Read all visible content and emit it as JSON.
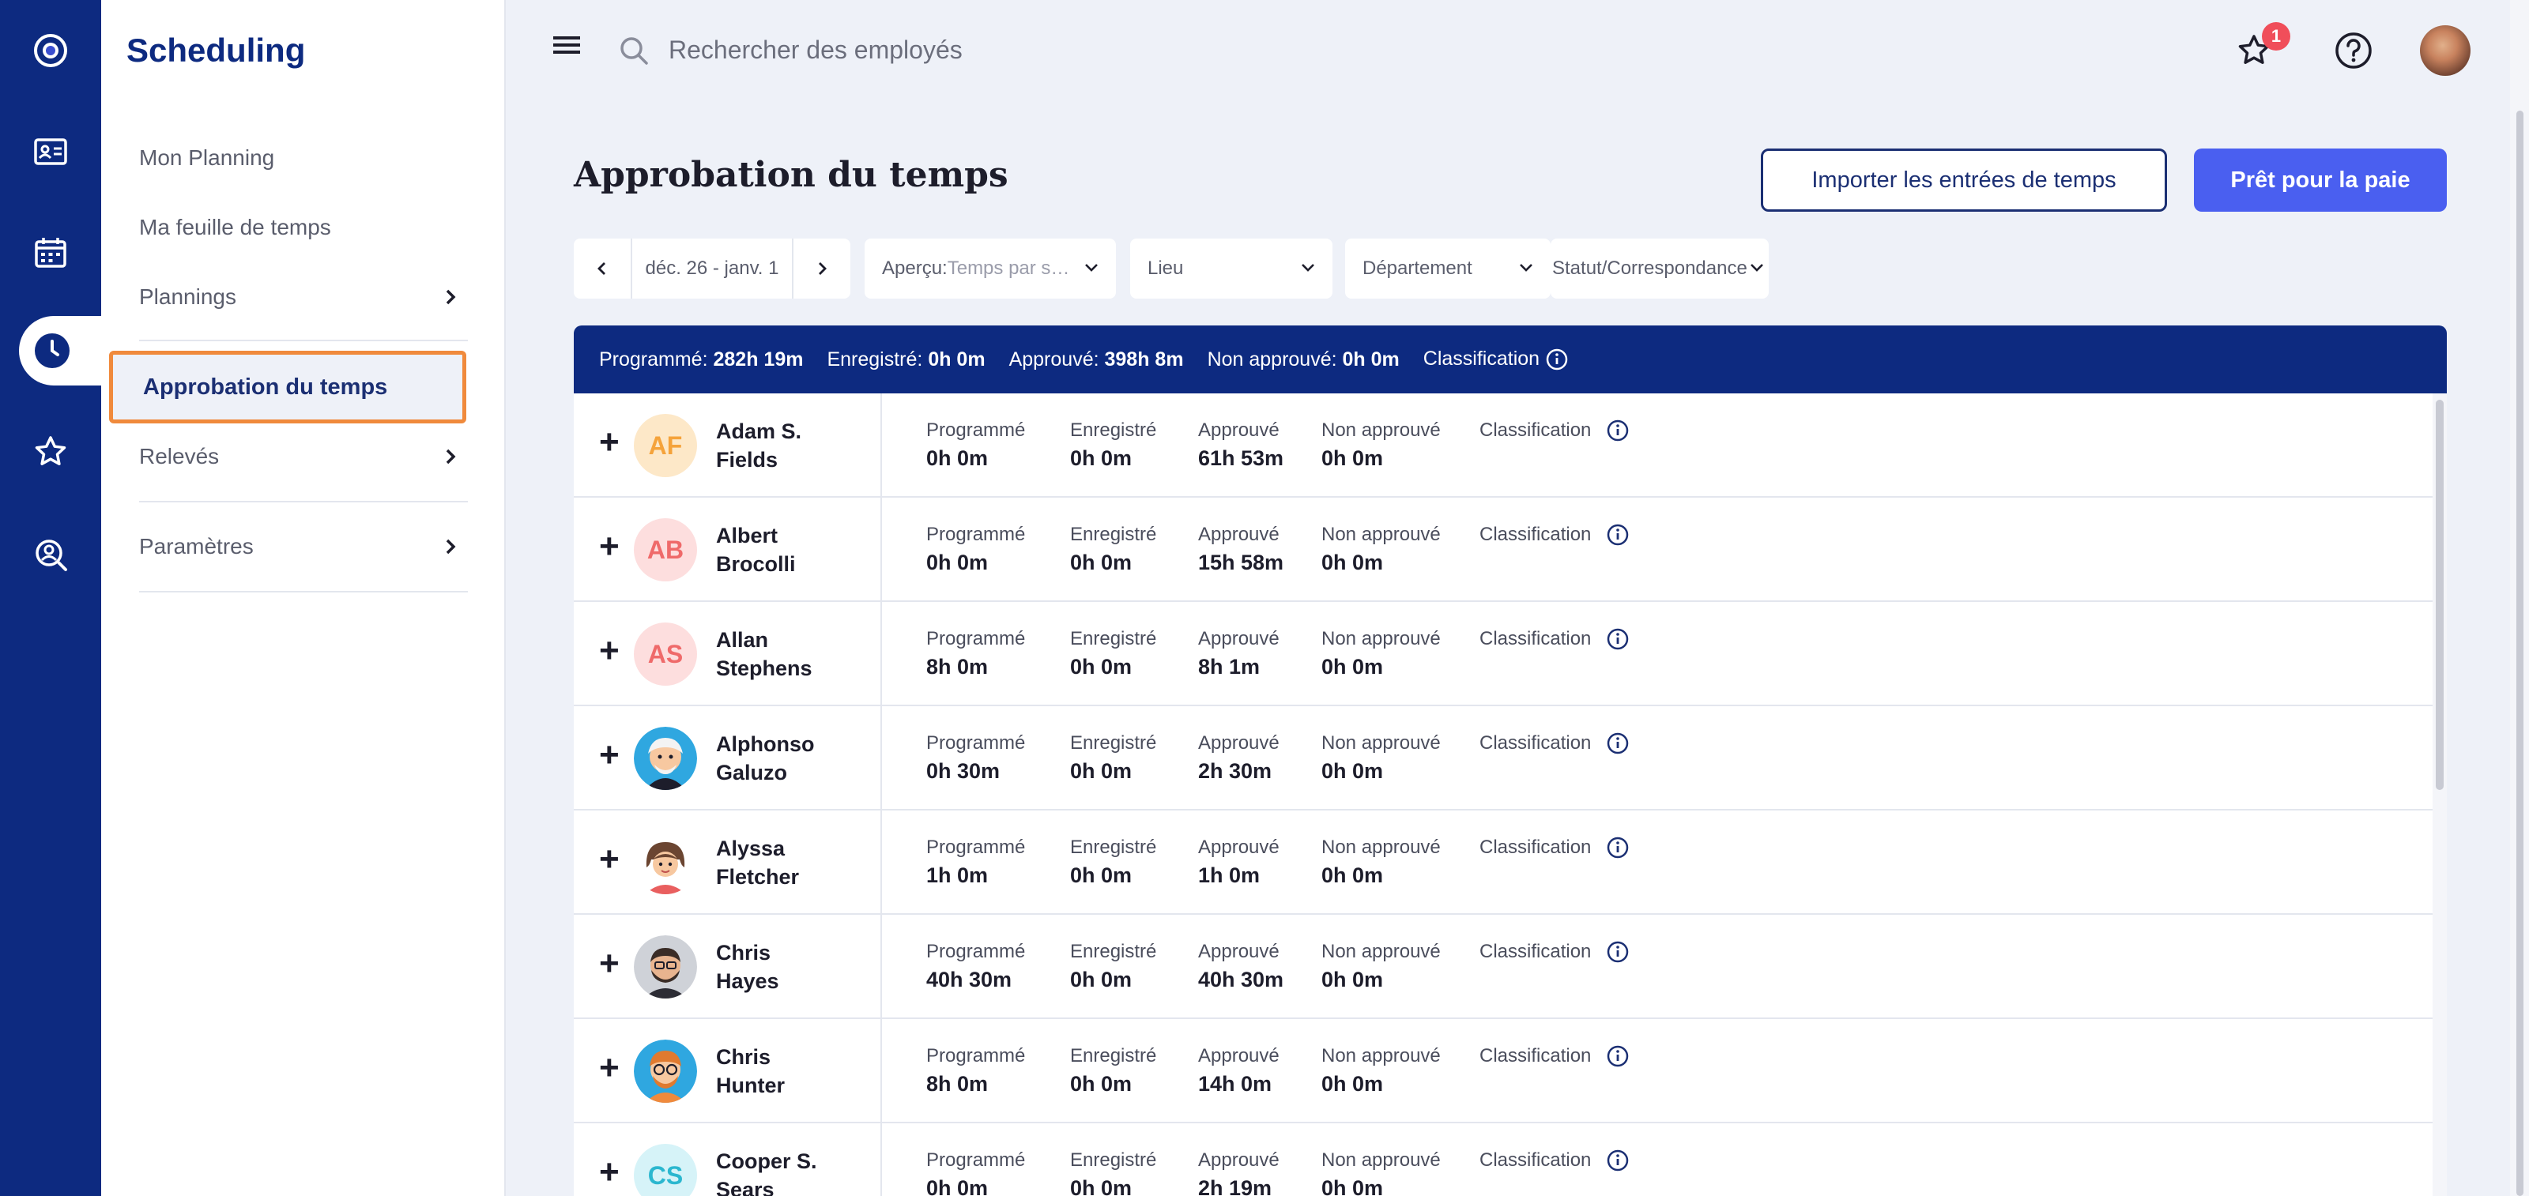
{
  "app": {
    "title": "Scheduling"
  },
  "rail": {
    "icons": [
      "logo-icon",
      "id-card-icon",
      "calendar-icon",
      "clock-icon",
      "star-icon",
      "person-search-icon"
    ],
    "active": "clock-icon",
    "color": "#0d2a80"
  },
  "sidebar": {
    "items": [
      {
        "label": "Mon Planning"
      },
      {
        "label": "Ma feuille de temps"
      },
      {
        "label": "Plannings"
      },
      {
        "label": "Approbation du temps"
      },
      {
        "label": "Relevés"
      },
      {
        "label": "Paramètres"
      }
    ],
    "active_label": "Approbation du temps",
    "highlight_color": "#f08a3c"
  },
  "header": {
    "search_placeholder": "Rechercher des employés",
    "notification_count": "1"
  },
  "page": {
    "title": "Approbation du temps",
    "import_button": "Importer les entrées de temps",
    "payroll_button": "Prêt pour la paie"
  },
  "filters": {
    "date_range": "déc. 26 - janv. 1",
    "view_label": "Aperçu:",
    "view_value": "Temps par s…",
    "location": "Lieu",
    "department": "Département",
    "status": "Statut/Correspondance"
  },
  "summary": {
    "scheduled_label": "Programmé:",
    "scheduled_value": "282h 19m",
    "recorded_label": "Enregistré:",
    "recorded_value": "0h 0m",
    "approved_label": "Approuvé:",
    "approved_value": "398h 8m",
    "unapproved_label": "Non approuvé:",
    "unapproved_value": "0h 0m",
    "classification_label": "Classification"
  },
  "columns": {
    "scheduled": "Programmé",
    "recorded": "Enregistré",
    "approved": "Approuvé",
    "unapproved": "Non approuvé",
    "classification": "Classification"
  },
  "employees": [
    {
      "initials": "AF",
      "first": "Adam S.",
      "last": "Fields",
      "scheduled": "0h 0m",
      "recorded": "0h 0m",
      "approved": "61h 53m",
      "unapproved": "0h 0m",
      "avatar_bg": "#fde8c8",
      "avatar_fg": "#f5a33b"
    },
    {
      "initials": "AB",
      "first": "Albert",
      "last": "Brocolli",
      "scheduled": "0h 0m",
      "recorded": "0h 0m",
      "approved": "15h 58m",
      "unapproved": "0h 0m",
      "avatar_bg": "#fddede",
      "avatar_fg": "#ef6a6a"
    },
    {
      "initials": "AS",
      "first": "Allan",
      "last": "Stephens",
      "scheduled": "8h 0m",
      "recorded": "0h 0m",
      "approved": "8h 1m",
      "unapproved": "0h 0m",
      "avatar_bg": "#fddede",
      "avatar_fg": "#ef6a6a"
    },
    {
      "initials": "",
      "first": "Alphonso",
      "last": "Galuzo",
      "scheduled": "0h 30m",
      "recorded": "0h 0m",
      "approved": "2h 30m",
      "unapproved": "0h 0m",
      "avatar_icon": "cartoon-avatar-icon"
    },
    {
      "initials": "",
      "first": "Alyssa",
      "last": "Fletcher",
      "scheduled": "1h 0m",
      "recorded": "0h 0m",
      "approved": "1h 0m",
      "unapproved": "0h 0m",
      "avatar_icon": "cartoon-avatar-icon"
    },
    {
      "initials": "",
      "first": "Chris",
      "last": "Hayes",
      "scheduled": "40h 30m",
      "recorded": "0h 0m",
      "approved": "40h 30m",
      "unapproved": "0h 0m",
      "avatar_icon": "cartoon-avatar-icon"
    },
    {
      "initials": "",
      "first": "Chris",
      "last": "Hunter",
      "scheduled": "8h 0m",
      "recorded": "0h 0m",
      "approved": "14h 0m",
      "unapproved": "0h 0m",
      "avatar_icon": "cartoon-avatar-icon"
    },
    {
      "initials": "CS",
      "first": "Cooper S.",
      "last": "Sears",
      "scheduled": "0h 0m",
      "recorded": "0h 0m",
      "approved": "2h 19m",
      "unapproved": "0h 0m",
      "avatar_bg": "#d6f3f8",
      "avatar_fg": "#2bb7cf"
    }
  ]
}
